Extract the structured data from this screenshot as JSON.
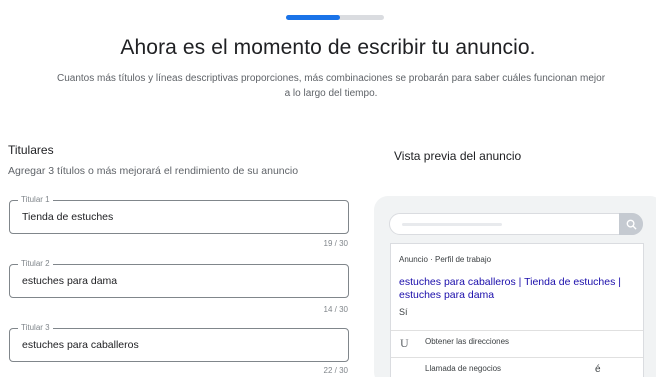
{
  "progress": {
    "fraction": 0.55,
    "color": "#1a73e8"
  },
  "page": {
    "title": "Ahora es el momento de escribir tu anuncio.",
    "subtitle_line1": "Cuantos más títulos y líneas descriptivas proporciones, más combinaciones se probarán para saber cuáles funcionan mejor",
    "subtitle_line2": "a lo largo del tiempo."
  },
  "headlines": {
    "title": "Titulares",
    "description": "Agregar 3 títulos o más mejorará el rendimiento de su anuncio",
    "fields": [
      {
        "label": "Titular 1",
        "value": "Tienda de estuches",
        "counter": "19 / 30"
      },
      {
        "label": "Titular 2",
        "value": "estuches para dama",
        "counter": "14 / 30"
      },
      {
        "label": "Titular 3",
        "value": "estuches para caballeros",
        "counter": "22 / 30"
      }
    ]
  },
  "preview": {
    "title": "Vista previa del anuncio",
    "ad_meta": "Anuncio · Perfil de trabajo",
    "headline": "estuches para caballeros | Tienda de estuches | estuches para dama",
    "description": "Sí",
    "extensions": [
      {
        "icon": "U",
        "label": "Obtener las direcciones",
        "icon_name": "directions-icon"
      },
      {
        "icon": "",
        "label": "Llamada de negocios",
        "extra": "é",
        "icon_name": "phone-icon"
      }
    ],
    "search_icon": "search-icon"
  }
}
